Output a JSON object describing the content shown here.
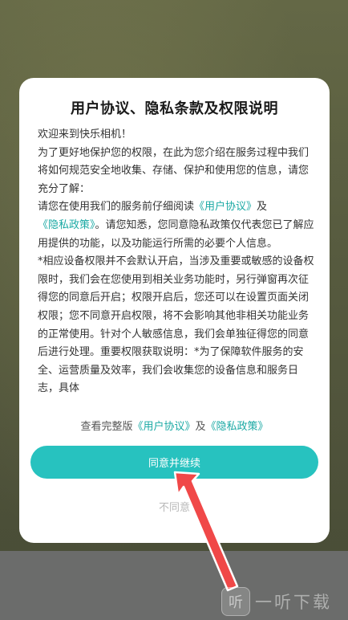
{
  "dialog": {
    "title": "用户协议、隐私条款及权限说明",
    "paragraphs": {
      "welcome": "欢迎来到快乐相机！",
      "intro": "为了更好地保护您的权限，在此为您介绍在服务过程中我们将如何规范安全地收集、存储、保护和使用您的信息，请您充分了解：",
      "read_prefix": "请您在使用我们的服务前仔细阅读",
      "user_agreement": "《用户协议》",
      "and": "及",
      "privacy_policy": "《隐私政策》",
      "read_suffix": "。请您知悉，您同意隐私政策仅代表您已了解应用提供的功能，以及功能运行所需的必要个人信息。",
      "permissions": "*相应设备权限并不会默认开启，当涉及重要或敏感的设备权限时，我们会在您使用到相关业务功能时，另行弹窗再次征得您的同意后开启；权限开启后，您还可以在设置页面关闭权限；您不同意开启权限，将不会影响其他非相关功能业务的正常使用。针对个人敏感信息，我们会单独征得您的同意后进行处理。重要权限获取说明：*为了保障软件服务的安全、运营质量及效率，我们会收集您的设备信息和服务日志，具体"
    },
    "footer": {
      "prefix": "查看完整版",
      "user_agreement": "《用户协议》",
      "and": "及",
      "privacy_policy": "《隐私政策》"
    },
    "agree_label": "同意并继续",
    "disagree_label": "不同意"
  },
  "watermark": {
    "logo_char": "听",
    "text": "一听下载"
  },
  "colors": {
    "accent": "#27c2bf",
    "link": "#1aa9a4",
    "arrow": "#f04848"
  }
}
